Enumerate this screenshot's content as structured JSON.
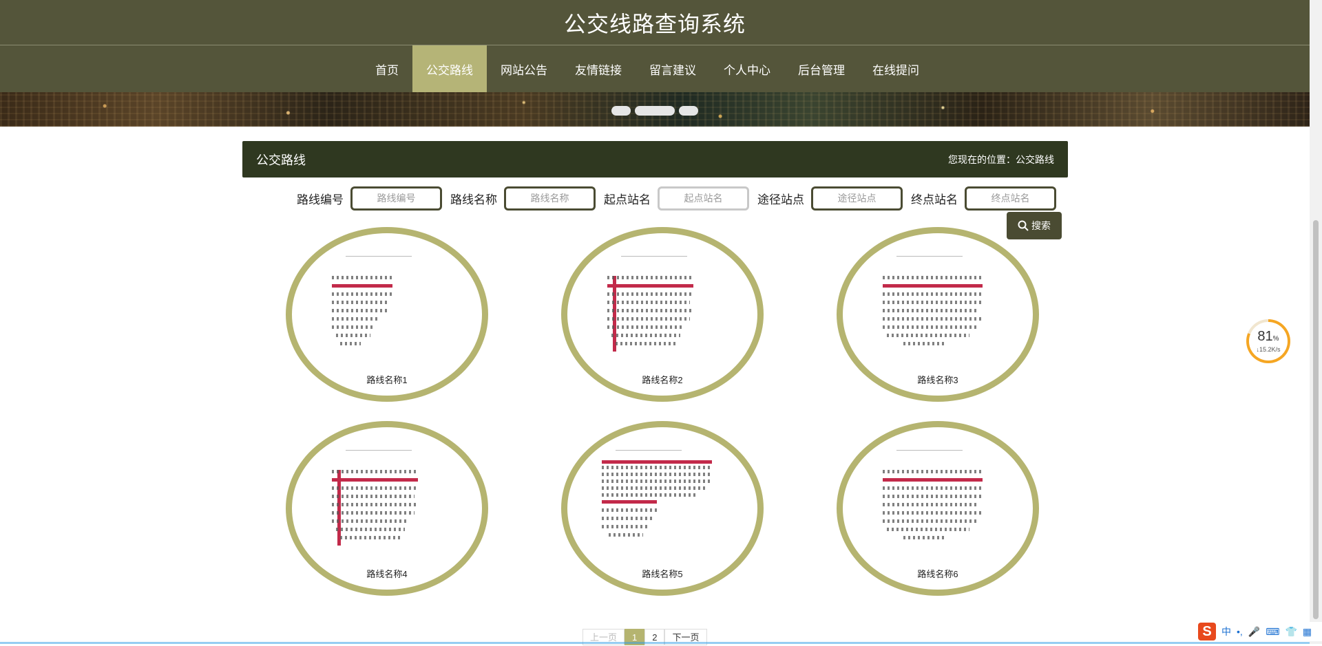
{
  "header": {
    "title": "公交线路查询系统"
  },
  "nav": {
    "items": [
      {
        "label": "首页"
      },
      {
        "label": "公交路线",
        "active": true
      },
      {
        "label": "网站公告"
      },
      {
        "label": "友情链接"
      },
      {
        "label": "留言建议"
      },
      {
        "label": "个人中心"
      },
      {
        "label": "后台管理"
      },
      {
        "label": "在线提问"
      }
    ]
  },
  "panel": {
    "title": "公交路线",
    "breadcrumb": "您现在的位置：公交路线"
  },
  "search": {
    "fields": [
      {
        "label": "路线编号",
        "placeholder": "路线编号",
        "value": ""
      },
      {
        "label": "路线名称",
        "placeholder": "路线名称",
        "value": ""
      },
      {
        "label": "起点站名",
        "placeholder": "起点站名",
        "value": ""
      },
      {
        "label": "途径站点",
        "placeholder": "途径站点",
        "value": ""
      },
      {
        "label": "终点站名",
        "placeholder": "终点站名",
        "value": ""
      }
    ],
    "button_label": "搜索",
    "button_icon": "search-icon"
  },
  "routes": [
    {
      "name": "路线名称1"
    },
    {
      "name": "路线名称2"
    },
    {
      "name": "路线名称3"
    },
    {
      "name": "路线名称4"
    },
    {
      "name": "路线名称5"
    },
    {
      "name": "路线名称6"
    }
  ],
  "pagination": {
    "prev": "上一页",
    "pages": [
      "1",
      "2"
    ],
    "current": "1",
    "next": "下一页"
  },
  "speed_widget": {
    "percent": "81",
    "unit": "%",
    "rate": "↓15.2K/s",
    "progress": 0.81
  },
  "ime": {
    "logo": "S",
    "mode": "中",
    "punct": "•,",
    "icons": [
      "mic-icon",
      "keyboard-icon",
      "shirt-icon",
      "grid-icon"
    ]
  },
  "colors": {
    "header_bg": "#54553a",
    "active_nav": "#b5b477",
    "panel_bg": "#2f3820",
    "ring": "#b5b470"
  }
}
